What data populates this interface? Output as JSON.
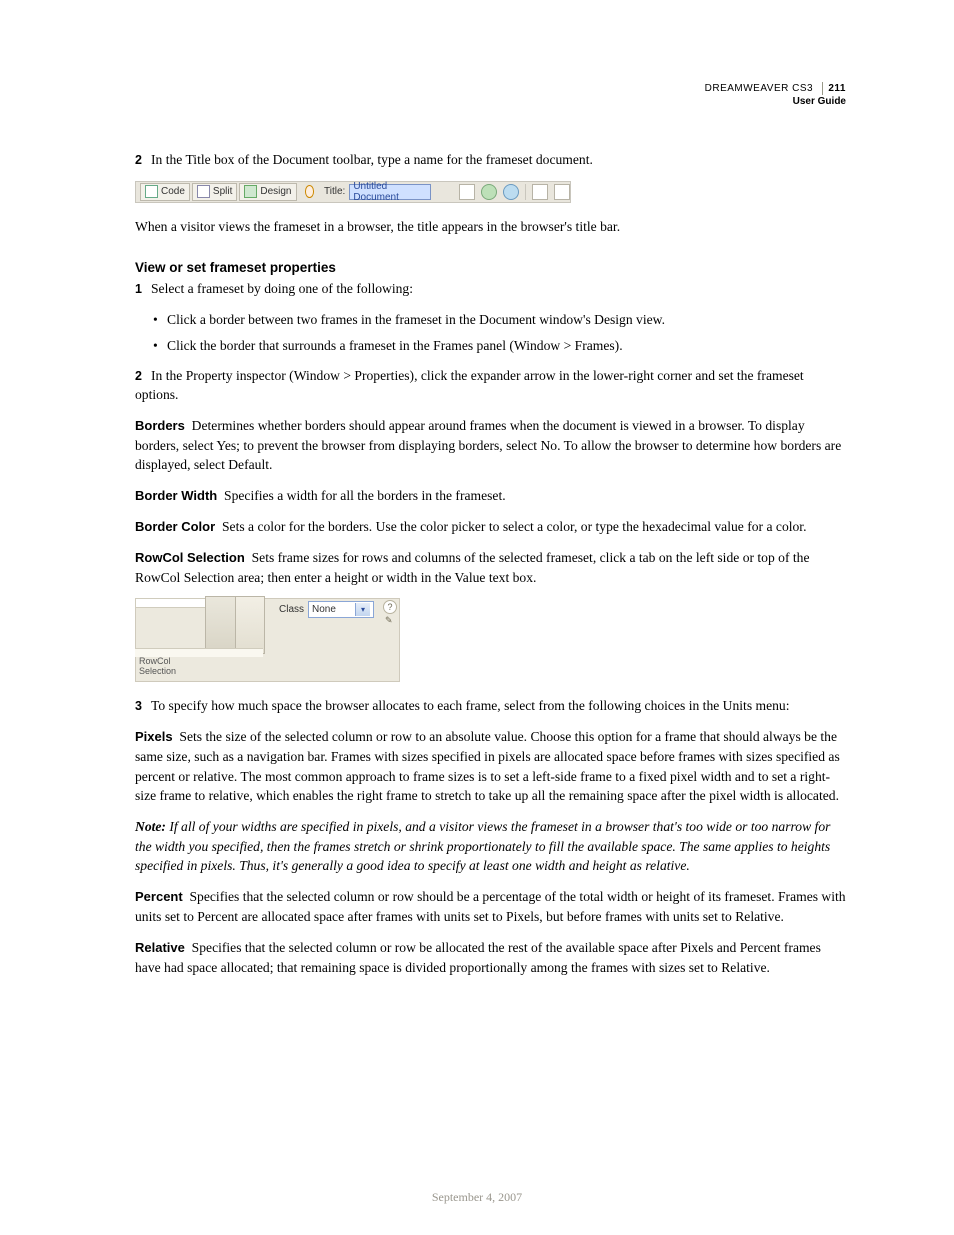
{
  "header": {
    "product": "DREAMWEAVER CS3",
    "page_number": "211",
    "subtitle": "User Guide"
  },
  "step2_intro": "In the Title box of the Document toolbar, type a name for the frameset document.",
  "toolbar": {
    "code": "Code",
    "split": "Split",
    "design": "Design",
    "title_label": "Title:",
    "title_value": "Untitled Document"
  },
  "after_toolbar": "When a visitor views the frameset in a browser, the title appears in the browser's title bar.",
  "section_heading": "View or set frameset properties",
  "s1": "Select a frameset by doing one of the following:",
  "b1": "Click a border between two frames in the frameset in the Document window's Design view.",
  "b2": "Click the border that surrounds a frameset in the Frames panel (Window > Frames).",
  "s2": "In the Property inspector (Window > Properties), click the expander arrow in the lower-right corner and set the frameset options.",
  "borders_label": "Borders",
  "borders_text": "Determines whether borders should appear around frames when the document is viewed in a browser. To display borders, select Yes; to prevent the browser from displaying borders, select No. To allow the browser to determine how borders are displayed, select Default.",
  "bw_label": "Border Width",
  "bw_text": "Specifies a width for all the borders in the frameset.",
  "bc_label": "Border Color",
  "bc_text": "Sets a color for the borders. Use the color picker to select a color, or type the hexadecimal value for a color.",
  "rc_label": "RowCol Selection",
  "rc_text": "Sets frame sizes for rows and columns of the selected frameset, click a tab on the left side or top of the RowCol Selection area; then enter a height or width in the Value text box.",
  "panel": {
    "rowcol1": "RowCol",
    "rowcol2": "Selection",
    "class_label": "Class",
    "class_value": "None"
  },
  "s3": "To specify how much space the browser allocates to each frame, select from the following choices in the Units menu:",
  "px_label": "Pixels",
  "px_text": "Sets the size of the selected column or row to an absolute value. Choose this option for a frame that should always be the same size, such as a navigation bar. Frames with sizes specified in pixels are allocated space before frames with sizes specified as percent or relative. The most common approach to frame sizes is to set a left-side frame to a fixed pixel width and to set a right-size frame to relative, which enables the right frame to stretch to take up all the remaining space after the pixel width is allocated.",
  "note_label": "Note:",
  "note_text": "If all of your widths are specified in pixels, and a visitor views the frameset in a browser that's too wide or too narrow for the width you specified, then the frames stretch or shrink proportionately to fill the available space. The same applies to heights specified in pixels. Thus, it's generally a good idea to specify at least one width and height as relative.",
  "pct_label": "Percent",
  "pct_text": "Specifies that the selected column or row should be a percentage of the total width or height of its frameset. Frames with units set to Percent are allocated space after frames with units set to Pixels, but before frames with units set to Relative.",
  "rel_label": "Relative",
  "rel_text": "Specifies that the selected column or row be allocated the rest of the available space after Pixels and Percent frames have had space allocated; that remaining space is divided proportionally among the frames with sizes set to Relative.",
  "footer_date": "September 4, 2007"
}
